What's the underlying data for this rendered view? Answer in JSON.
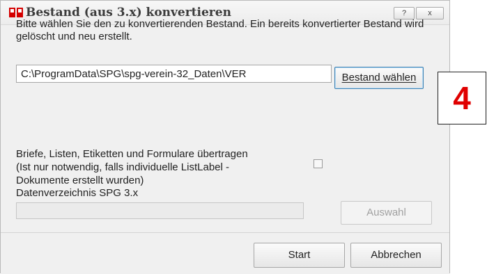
{
  "window": {
    "title": "Bestand (aus 3.x) konvertieren",
    "help_label": "?",
    "close_label": "x"
  },
  "content": {
    "description": "Bitte wählen Sie den zu konvertierenden Bestand. Ein bereits konvertierter Bestand wird gelöscht und neu erstellt.",
    "path_value": "C:\\ProgramData\\SPG\\spg-verein-32_Daten\\VER",
    "bestand_button": "Bestand wählen",
    "transfer_label_line1": "Briefe, Listen, Etiketten und Formulare übertragen",
    "transfer_label_line2": "(Ist nur notwendig, falls individuelle ListLabel -",
    "transfer_label_line3": "Dokumente erstellt wurden)",
    "transfer_checked": false,
    "dir_label": "Datenverzeichnis SPG 3.x",
    "dir_value": "",
    "auswahl_button": "Auswahl"
  },
  "footer": {
    "start_button": "Start",
    "cancel_button": "Abbrechen"
  },
  "annotation": {
    "number": "4",
    "color": "#e00000"
  }
}
